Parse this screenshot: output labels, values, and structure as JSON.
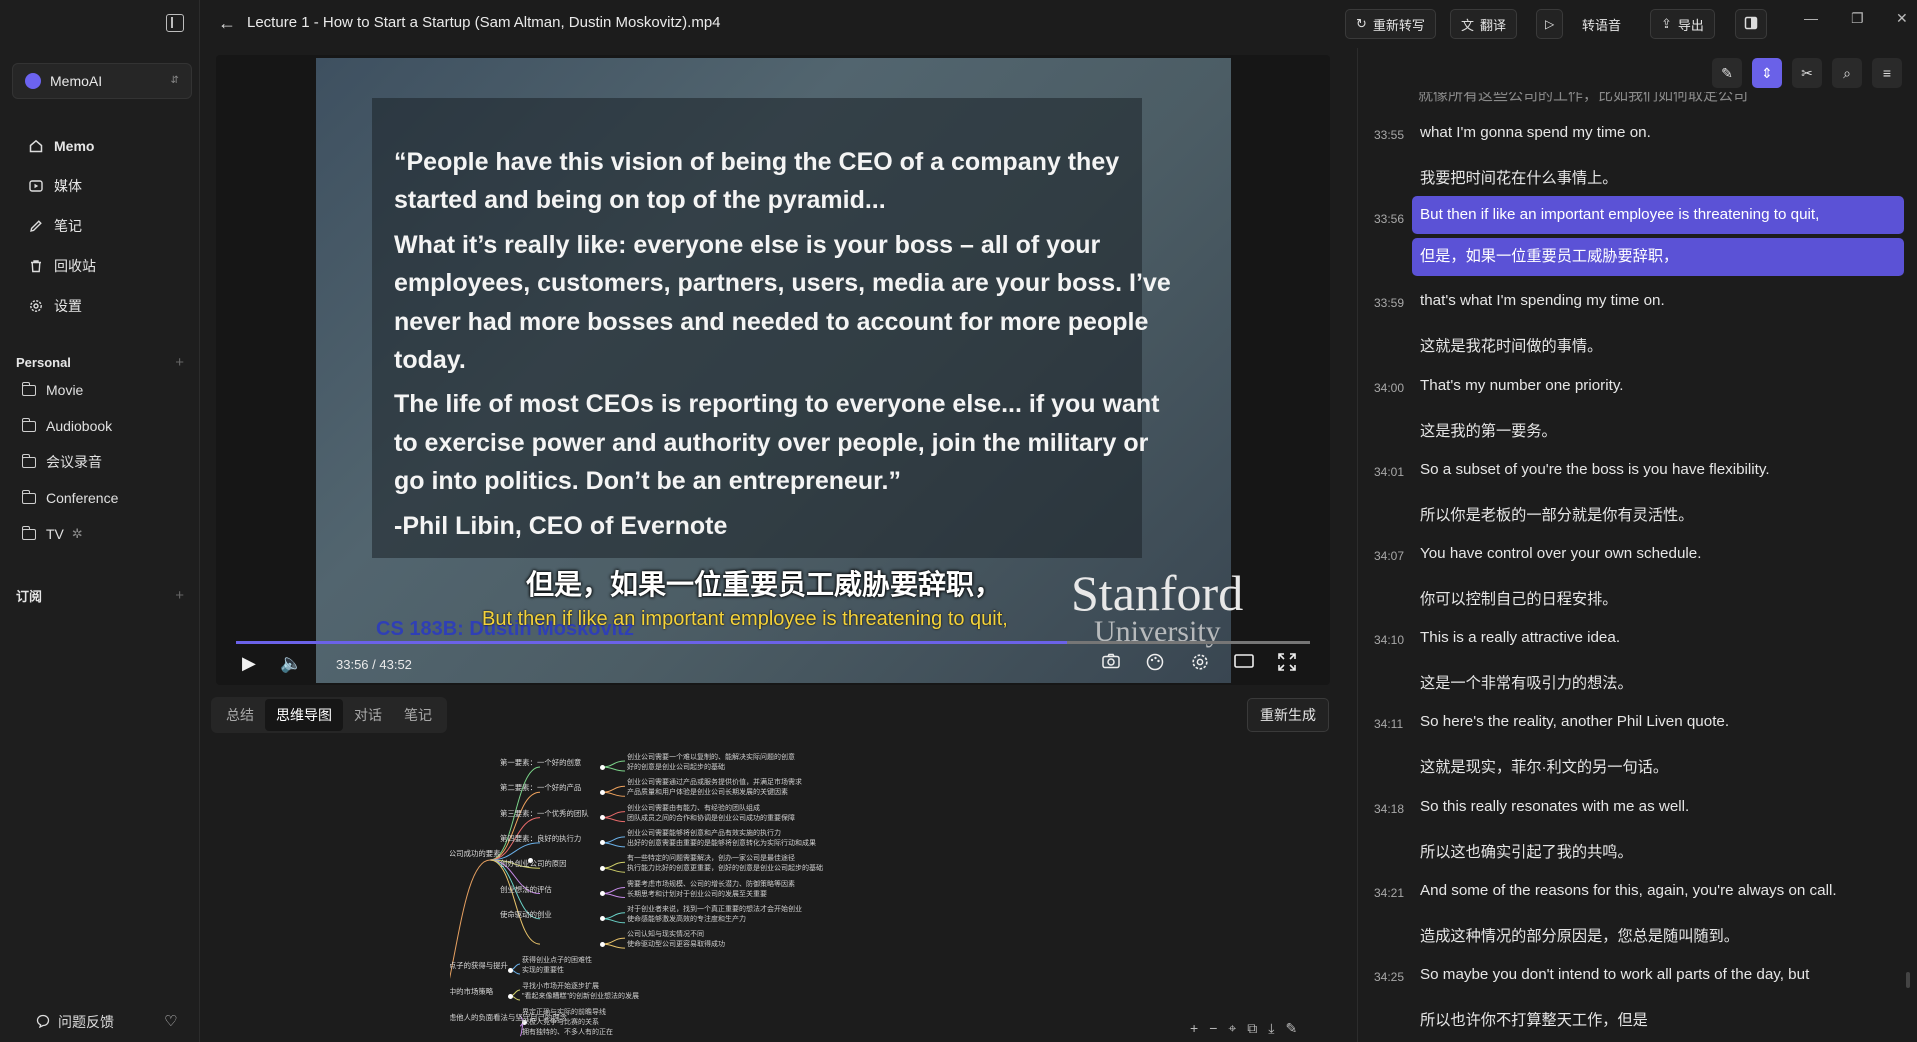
{
  "sidebar": {
    "workspace_name": "MemoAI",
    "nav": [
      {
        "label": "Memo",
        "icon": "home-icon"
      },
      {
        "label": "媒体",
        "icon": "media-icon"
      },
      {
        "label": "笔记",
        "icon": "pencil-icon"
      },
      {
        "label": "回收站",
        "icon": "trash-icon"
      },
      {
        "label": "设置",
        "icon": "gear-icon"
      }
    ],
    "personal_heading": "Personal",
    "folders": [
      "Movie",
      "Audiobook",
      "会议录音",
      "Conference",
      "TV"
    ],
    "subscription_heading": "订阅",
    "feedback_label": "问题反馈"
  },
  "header": {
    "title": "Lecture 1 - How to Start a Startup (Sam Altman, Dustin Moskovitz).mp4",
    "retranscribe_label": "重新转写",
    "translate_label": "翻译",
    "to_speech_label": "转语音",
    "export_label": "导出"
  },
  "video": {
    "quote": [
      "“People have this vision of being the CEO of a company they started and being on top of the pyramid...",
      "What it’s really like: everyone else is your boss – all of your employees, customers, partners, users, media are your boss. I’ve never had more bosses and needed to account for more people today.",
      "The life of most CEOs is reporting to everyone else... if you want to exercise power and authority over people, join the military or go into politics. Don’t be an entrepreneur.”",
      "-Phil Libin, CEO of Evernote"
    ],
    "stanford": "Stanford",
    "university": "University",
    "course": "CS 183B: Dustin Moskovitz",
    "subtitle_cn": "但是，如果一位重要员工威胁要辞职，",
    "subtitle_en": "But then if like an important employee is threatening to quit,",
    "time_display": "33:56 / 43:52",
    "progress_fraction": 0.7736
  },
  "panel": {
    "tabs": [
      "总结",
      "思维导图",
      "对话",
      "笔记"
    ],
    "active_tab": "思维导图",
    "regenerate_label": "重新生成"
  },
  "mindmap": {
    "root": "创业公司成功的要素",
    "branches": [
      {
        "label": "第一要素：一个好的创意",
        "leaves": [
          "创业公司需要一个难以复制的、能解决实际问题的创意",
          "好的创意是创业公司起步的基础"
        ]
      },
      {
        "label": "第二要素：一个好的产品",
        "leaves": [
          "创业公司需要通过产品或服务提供价值，并满足市场需求",
          "产品质量和用户体验是创业公司长期发展的关键因素"
        ]
      },
      {
        "label": "第三要素：一个优秀的团队",
        "leaves": [
          "创业公司需要由有能力、有经验的团队组成",
          "团队成员之间的合作和协调是创业公司成功的重要保障"
        ]
      },
      {
        "label": "第四要素：良好的执行力",
        "leaves": [
          "创业公司需要能够将创意和产品有效实施的执行力",
          "出好的创意需要由重要的是能够将创意转化为实际行动和成果"
        ]
      },
      {
        "label": "创办创业公司的原因",
        "leaves": [
          "有一些特定的问题需要解决，创办一家公司是最佳途径",
          "执行能力比好的创意更重要，创好的创意是创业公司起步的基础"
        ]
      },
      {
        "label": "创业想法的评估",
        "leaves": [
          "需要考虑市场规模、公司的增长潜力、防御策略等因素",
          "长期思考和计划对于创业公司的发展至关重要"
        ]
      },
      {
        "label": "使命驱动的创业",
        "leaves": [
          "对于创业者来说，找到一个真正重要的想法才会开始创业",
          "使命感能够激发高效的专注度和生产力"
        ]
      },
      {
        "label": "",
        "leaves": [
          "公司认知与现实情况不同",
          "使命驱动型公司更容易取得成功"
        ]
      }
    ],
    "more_branches": [
      {
        "label": "创业点子的获得与提升",
        "leaves": [
          "获得创业点子的困难性",
          "实现的重要性"
        ]
      },
      {
        "label": "创业中的市场策略",
        "leaves": [
          "寻找小市场开始逐步扩展",
          "\"看起来像糟糕\"的创新创业想法的发展"
        ]
      },
      {
        "label": "在考虑他人的负面看法与坚守自己的理念",
        "leaves": [
          "界定正确与实际的前瞻导线",
          "积极人竞争与比赛的关系",
          "拥有独特的、不多人有的正在"
        ]
      }
    ]
  },
  "transcript": {
    "partial_top": "就像所有这些公司的工作，比如我们如何取定公司",
    "items": [
      {
        "time": "33:55",
        "en": "what I'm gonna spend my time on.",
        "zh": "我要把时间花在什么事情上。",
        "active": false
      },
      {
        "time": "33:56",
        "en": "But then if like an important employee is threatening to quit,",
        "zh": "但是，如果一位重要员工威胁要辞职，",
        "active": true
      },
      {
        "time": "33:59",
        "en": "that's what I'm spending my time on.",
        "zh": "这就是我花时间做的事情。",
        "active": false
      },
      {
        "time": "34:00",
        "en": "That's my number one priority.",
        "zh": "这是我的第一要务。",
        "active": false
      },
      {
        "time": "34:01",
        "en": "So a subset of you're the boss is you have flexibility.",
        "zh": "所以你是老板的一部分就是你有灵活性。",
        "active": false
      },
      {
        "time": "34:07",
        "en": "You have control over your own schedule.",
        "zh": "你可以控制自己的日程安排。",
        "active": false
      },
      {
        "time": "34:10",
        "en": "This is a really attractive idea.",
        "zh": "这是一个非常有吸引力的想法。",
        "active": false
      },
      {
        "time": "34:11",
        "en": "So here's the reality, another Phil Liven quote.",
        "zh": "这就是现实，菲尔·利文的另一句话。",
        "active": false
      },
      {
        "time": "34:18",
        "en": "So this really resonates with me as well.",
        "zh": "所以这也确实引起了我的共鸣。",
        "active": false
      },
      {
        "time": "34:21",
        "en": "And some of the reasons for this, again, you're always on call.",
        "zh": "造成这种情况的部分原因是，您总是随叫随到。",
        "active": false
      },
      {
        "time": "34:25",
        "en": "So maybe you don't intend to work all parts of the day, but",
        "zh": "所以也许你不打算整天工作，但是",
        "active": false
      }
    ]
  },
  "colors": {
    "accent": "#6a61e8",
    "subtitle_en": "#f4d23a",
    "background": "#1c1c1c"
  }
}
